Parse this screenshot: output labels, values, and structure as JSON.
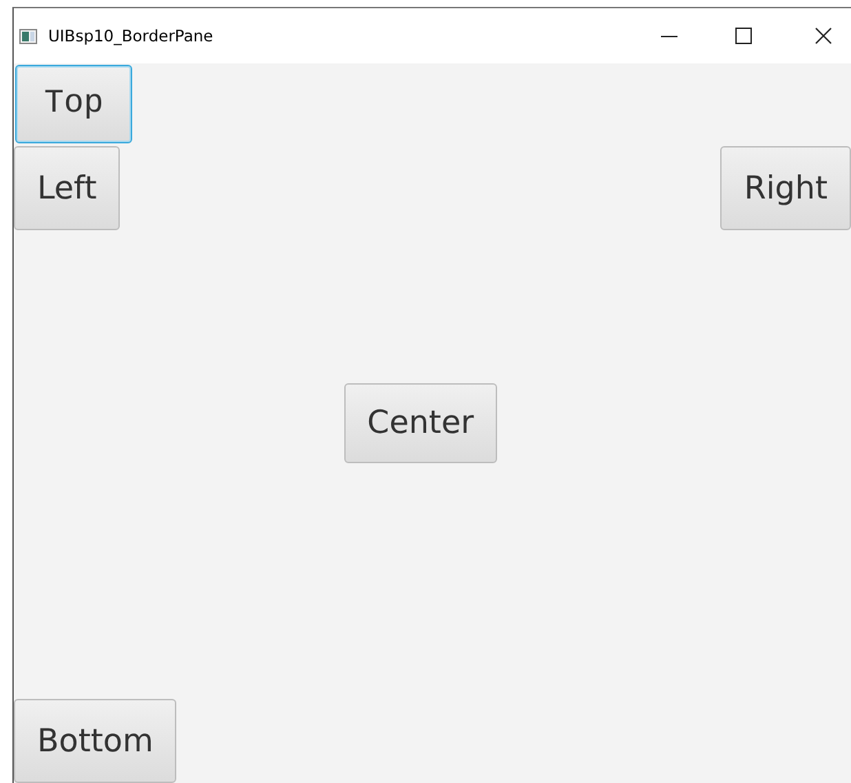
{
  "window": {
    "title": "UIBsp10_BorderPane"
  },
  "buttons": [
    {
      "label": "Top",
      "kind": "top",
      "focused": true
    },
    {
      "label": "Left",
      "kind": "left",
      "focused": false
    },
    {
      "label": "Center",
      "kind": "center",
      "focused": false
    },
    {
      "label": "Right",
      "kind": "right",
      "focused": false
    },
    {
      "label": "Bottom",
      "kind": "bottom",
      "focused": false
    }
  ]
}
